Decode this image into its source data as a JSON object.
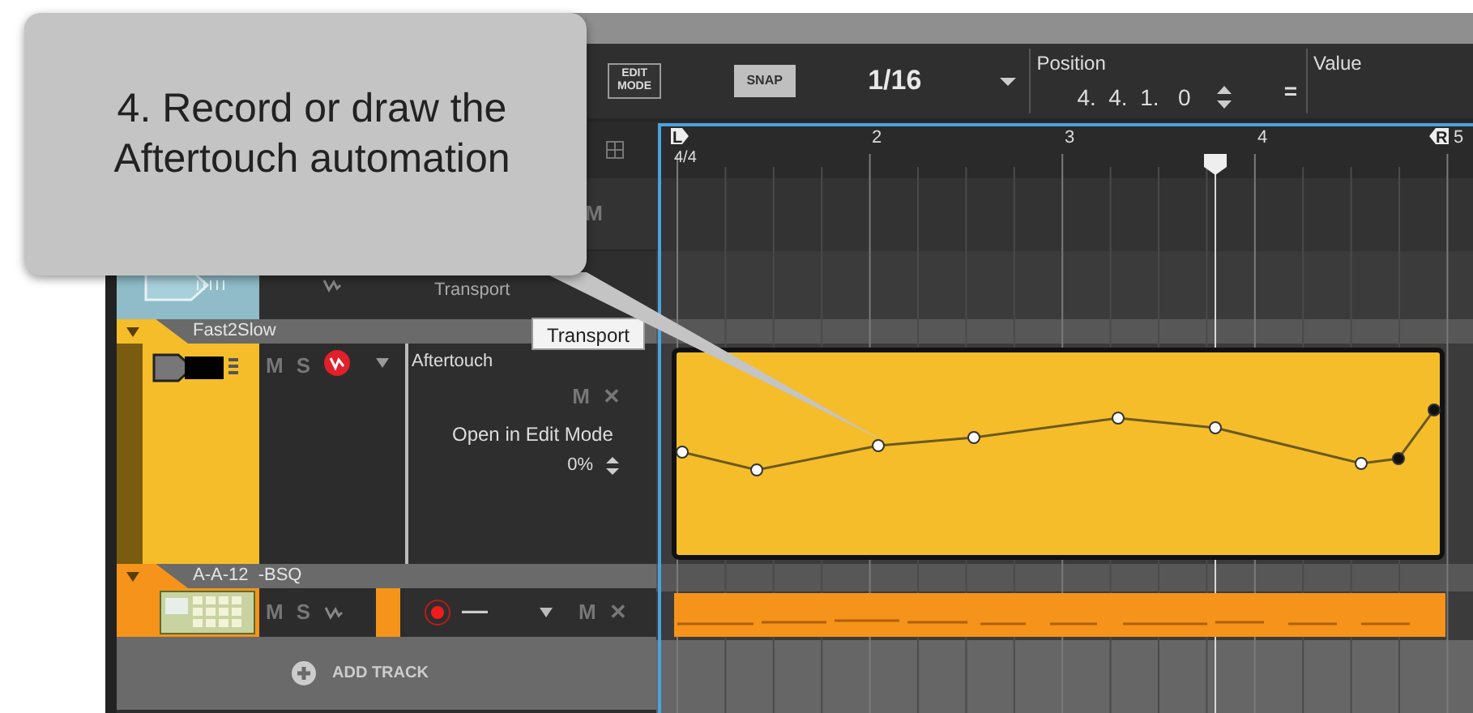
{
  "callout": {
    "text": "4. Record or draw the Aftertouch automation"
  },
  "toolbar": {
    "edit_mode_button": "EDIT MODE",
    "snap_button": "SNAP",
    "grid": "1/16",
    "position": {
      "label": "Position",
      "value": "4.  4.  1.   0"
    },
    "equals": "=",
    "value_label": "Value"
  },
  "ruler": {
    "loop_start": "L",
    "loop_end": "R",
    "time_signature": "4/4",
    "bars": [
      {
        "label": "2"
      },
      {
        "label": "3"
      },
      {
        "label": "4"
      },
      {
        "label": "5"
      }
    ]
  },
  "tracks": [
    {
      "kind": "lane",
      "mute": "M"
    },
    {
      "kind": "transport",
      "label": "Transport"
    },
    {
      "kind": "group",
      "name": "Fast2Slow",
      "color": "#f5bd2a",
      "mute": "M",
      "solo": "S",
      "lane": {
        "kind": "automation",
        "name": "Aftertouch",
        "mute": "M",
        "remove": "✕",
        "action": "Open in Edit Mode",
        "amount": "0%"
      }
    },
    {
      "kind": "group",
      "name": "A-A-12  -BSQ",
      "color": "#f5931a",
      "mute": "M",
      "solo": "S",
      "lane": {
        "kind": "record",
        "armed": true,
        "dash": "—",
        "mute": "M",
        "remove": "✕"
      }
    }
  ],
  "tooltip": "Transport",
  "add_track": "ADD TRACK"
}
